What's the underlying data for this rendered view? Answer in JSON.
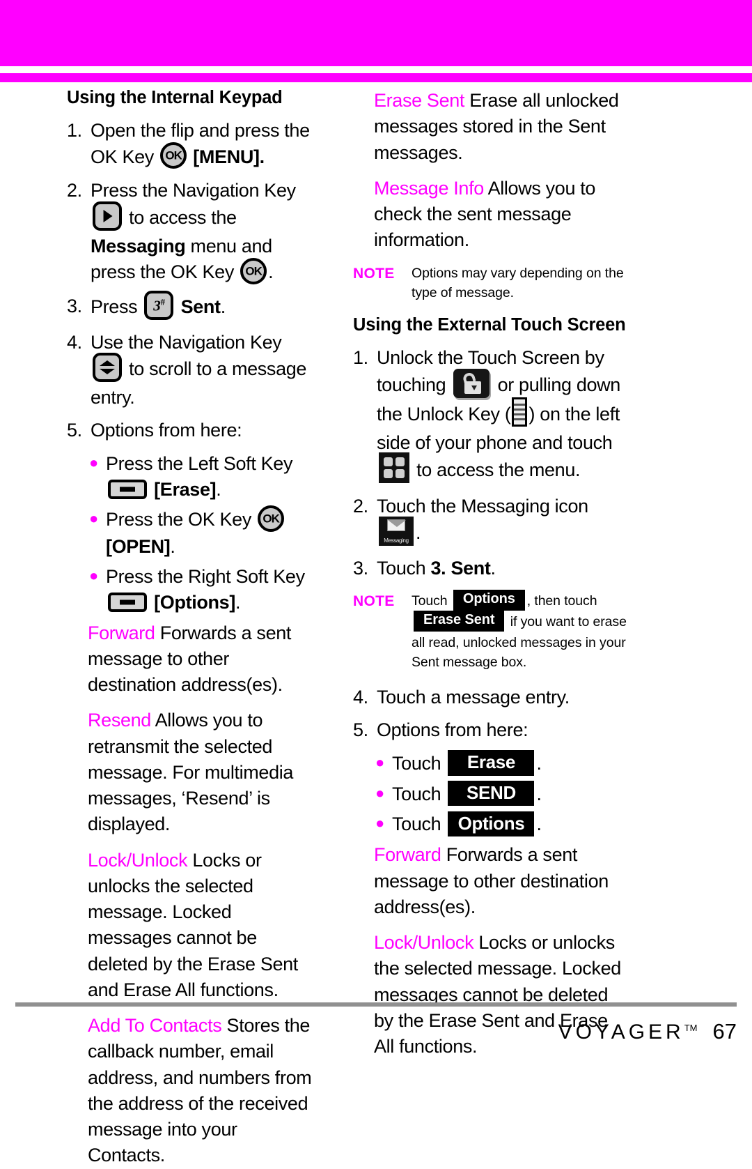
{
  "colors": {
    "accent_magenta": "#ff00ff",
    "footer_rule_gray": "#909090",
    "chip_black": "#000000",
    "key_fill_gray": "#c9c9c9"
  },
  "left_column": {
    "section_title": "Using the Internal Keypad",
    "steps": [
      {
        "num": "1.",
        "text_a": "Open the flip and press the OK Key",
        "icon": "ok-key-icon",
        "text_b": "[MENU]."
      },
      {
        "num": "2.",
        "text_a": "Press the Navigation Key",
        "icon": "nav-right-key-icon",
        "text_b": "to access the",
        "bold_b": "Messaging",
        "text_c": "menu and press the OK Key",
        "icon2": "ok-key-icon",
        "text_d": "."
      },
      {
        "num": "3.",
        "text_a": "Press",
        "icon": "key-3-icon",
        "bold_b": "Sent",
        "text_b": "."
      },
      {
        "num": "4.",
        "text_a": "Use the Navigation Key",
        "icon": "nav-updown-key-icon",
        "text_b": "to scroll to a message entry."
      },
      {
        "num": "5.",
        "text_a": "Options from here:"
      }
    ],
    "bullets": [
      {
        "text_a": "Press the Left Soft Key",
        "icon": "soft-key-icon",
        "bold_b": "[Erase]",
        "text_b": "."
      },
      {
        "text_a": "Press the OK Key",
        "icon": "ok-key-icon",
        "bold_b": "[OPEN]",
        "text_b": "."
      },
      {
        "text_a": "Press the Right Soft Key",
        "icon": "soft-key-icon",
        "bold_b": "[Options]",
        "text_b": "."
      }
    ],
    "terms": [
      {
        "term": "Forward",
        "desc": "Forwards a sent message to other destination address(es)."
      },
      {
        "term": "Resend",
        "desc": "Allows you to retransmit the selected message. For multimedia messages, ‘Resend’ is displayed."
      },
      {
        "term": "Lock/Unlock",
        "desc": "Locks or unlocks the selected message. Locked messages cannot be deleted by the Erase Sent and Erase All functions."
      },
      {
        "term": "Add To Contacts",
        "desc": "Stores the callback number, email address, and numbers from the address of the received message into your Contacts."
      }
    ]
  },
  "right_column": {
    "terms_top": [
      {
        "term": "Erase Sent",
        "desc": "Erase all unlocked messages stored in the Sent messages."
      },
      {
        "term": "Message Info",
        "desc": "Allows you to check the sent message information."
      }
    ],
    "note_1": {
      "label": "NOTE",
      "text": "Options may vary depending on the type of message."
    },
    "section_title": "Using the External Touch Screen",
    "steps": [
      {
        "num": "1.",
        "text_a": "Unlock the Touch Screen by touching",
        "icon": "unlock-padlock-icon",
        "text_b": "or pulling down the Unlock Key (",
        "icon2": "unlock-key-bar-icon",
        "text_c": ") on the left side of your phone and touch",
        "icon3": "grid-menu-icon",
        "text_d": "to access the menu."
      },
      {
        "num": "2.",
        "text_a": "Touch the Messaging icon",
        "icon": "messaging-tile-icon",
        "text_b": "."
      },
      {
        "num": "3.",
        "text_a": "Touch",
        "bold_b": "3. Sent",
        "text_b": "."
      }
    ],
    "note_2": {
      "label": "NOTE",
      "text_a": "Touch",
      "chip_a": "Options",
      "text_b": ", then touch",
      "chip_b": "Erase Sent",
      "text_c": "if you want to erase all read, unlocked messages in your Sent message box."
    },
    "steps_2": [
      {
        "num": "4.",
        "text_a": "Touch a message entry."
      },
      {
        "num": "5.",
        "text_a": "Options from here:"
      }
    ],
    "bullets": [
      {
        "text_a": "Touch",
        "chip": "Erase",
        "text_b": "."
      },
      {
        "text_a": "Touch",
        "chip": "SEND",
        "text_b": "."
      },
      {
        "text_a": "Touch",
        "chip": "Options",
        "text_b": "."
      }
    ],
    "terms_bottom": [
      {
        "term": "Forward",
        "desc": "Forwards a sent message to other destination address(es)."
      },
      {
        "term": "Lock/Unlock",
        "desc": "Locks or unlocks the selected message. Locked messages cannot be deleted by the Erase Sent and Erase All functions."
      }
    ]
  },
  "footer": {
    "brand": "VOYAGER",
    "trademark": "TM",
    "page_number": "67"
  },
  "icons": {
    "ok_key_label": "OK",
    "key_3_label": "3",
    "key_3_sup": "#",
    "messaging_caption": "Messaging"
  }
}
